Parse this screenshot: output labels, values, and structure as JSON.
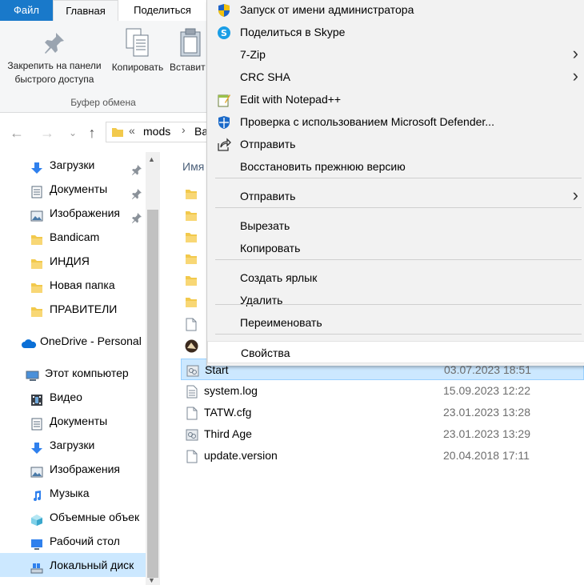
{
  "ribbon": {
    "tabs": [
      "Файл",
      "Главная",
      "Поделиться"
    ],
    "pin_label_1": "Закрепить на панели",
    "pin_label_2": "быстрого доступа",
    "copy_label": "Копировать",
    "paste_label": "Вставит",
    "group_label": "Буфер обмена"
  },
  "address": {
    "prefix": "«",
    "segment1": "mods",
    "segment2": "Ba"
  },
  "sidebar": {
    "quick_access": [
      {
        "label": "Загрузки",
        "icon": "download-icon",
        "pinned": true
      },
      {
        "label": "Документы",
        "icon": "documents-icon",
        "pinned": true
      },
      {
        "label": "Изображения",
        "icon": "pictures-icon",
        "pinned": true
      },
      {
        "label": "Bandicam",
        "icon": "folder-icon",
        "pinned": false
      },
      {
        "label": "ИНДИЯ",
        "icon": "folder-icon",
        "pinned": false
      },
      {
        "label": "Новая папка",
        "icon": "folder-icon",
        "pinned": false
      },
      {
        "label": "ПРАВИТЕЛИ",
        "icon": "folder-icon",
        "pinned": false
      }
    ],
    "onedrive": "OneDrive - Personal",
    "this_pc": "Этот компьютер",
    "pc_items": [
      {
        "label": "Видео",
        "icon": "video-icon"
      },
      {
        "label": "Документы",
        "icon": "documents-icon"
      },
      {
        "label": "Загрузки",
        "icon": "download-icon"
      },
      {
        "label": "Изображения",
        "icon": "pictures-icon"
      },
      {
        "label": "Музыка",
        "icon": "music-icon"
      },
      {
        "label": "Объемные объек",
        "icon": "3d-objects-icon"
      },
      {
        "label": "Рабочий стол",
        "icon": "desktop-icon"
      },
      {
        "label": "Локальный диск",
        "icon": "drive-icon"
      }
    ]
  },
  "file_list": {
    "header_name": "Имя",
    "rows": [
      {
        "name": "Start",
        "date": "03.07.2023 18:51",
        "icon": "shortcut-icon",
        "selected": true
      },
      {
        "name": "system.log",
        "date": "15.09.2023 12:22",
        "icon": "text-file-icon"
      },
      {
        "name": "TATW.cfg",
        "date": "23.01.2023 13:28",
        "icon": "file-icon"
      },
      {
        "name": "Third Age",
        "date": "23.01.2023 13:29",
        "icon": "shortcut-icon"
      },
      {
        "name": "update.version",
        "date": "20.04.2018 17:11",
        "icon": "file-icon"
      }
    ]
  },
  "context_menu": {
    "items": [
      {
        "label": "Запуск от имени администратора",
        "icon": "uac-shield-icon"
      },
      {
        "label": "Поделиться в Skype",
        "icon": "skype-icon"
      },
      {
        "label": "7-Zip",
        "submenu": true
      },
      {
        "label": "CRC SHA",
        "submenu": true
      },
      {
        "label": "Edit with Notepad++",
        "icon": "notepadpp-icon"
      },
      {
        "label": "Проверка с использованием Microsoft Defender...",
        "icon": "defender-icon"
      },
      {
        "label": "Отправить",
        "icon": "share-icon"
      },
      {
        "label": "Восстановить прежнюю версию"
      },
      {
        "label": "Отправить",
        "submenu": true
      },
      {
        "label": "Вырезать"
      },
      {
        "label": "Копировать"
      },
      {
        "label": "Создать ярлык"
      },
      {
        "label": "Удалить"
      },
      {
        "label": "Переименовать"
      },
      {
        "label": "Свойства",
        "hovered": true
      }
    ]
  },
  "colors": {
    "accent": "#1979ca",
    "selection": "#cce8ff",
    "folder": "#f2c94c"
  }
}
